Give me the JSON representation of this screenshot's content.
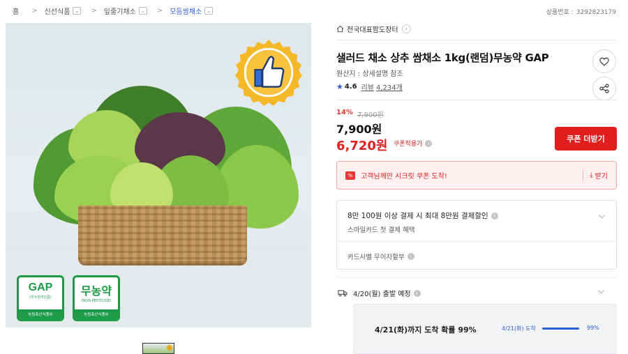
{
  "breadcrumb": {
    "items": [
      {
        "label": "홈"
      },
      {
        "label": "신선식품"
      },
      {
        "label": "잎줄기채소"
      },
      {
        "label": "모듬쌈채소"
      }
    ]
  },
  "product_no": {
    "label": "상품번호 :",
    "value": "3292823179"
  },
  "hero": {
    "certs": [
      {
        "main": "GAP",
        "sub": "(우수관리인증)",
        "foot": "농림축산식품부"
      },
      {
        "main": "무농약",
        "sub": "(NON PESTICIDE)",
        "foot": "농림축산식품부"
      }
    ]
  },
  "store": {
    "name": "전국대표팜도장터"
  },
  "product": {
    "title": "샐러드 채소 상추 쌈채소 1kg(랜덤)무농약 GAP",
    "origin": "원산지 : 상세설명 참조",
    "rating": "4.6",
    "review_label": "리뷰",
    "review_count": "4,234개"
  },
  "price": {
    "discount_rate": "14%",
    "original": "7,900원",
    "sale": "7,900원",
    "coupon": "6,720원",
    "coupon_note": "쿠폰적용가",
    "coupon_button": "쿠폰 더받기"
  },
  "secret_coupon": {
    "text": "고객님께만 시크릿 쿠폰 도착!",
    "download": "받기"
  },
  "card_benefit": {
    "title": "8만 100원 이상 결제 시 최대 8만원 결제할인",
    "sub": "스마일카드 첫 결제 혜택",
    "installment": "카드사별 무이자할부"
  },
  "shipping": {
    "departure": "4/20(월) 출발 예정",
    "arrival": "4/21(화)까지 도착 확률 99%",
    "day_label": "4/21(화) 도착",
    "probability": 0.99,
    "probability_label": "99%"
  },
  "colors": {
    "accent_red": "#e01e1e",
    "accent_blue": "#2b5fd9",
    "cert_green": "#1d9b47"
  }
}
